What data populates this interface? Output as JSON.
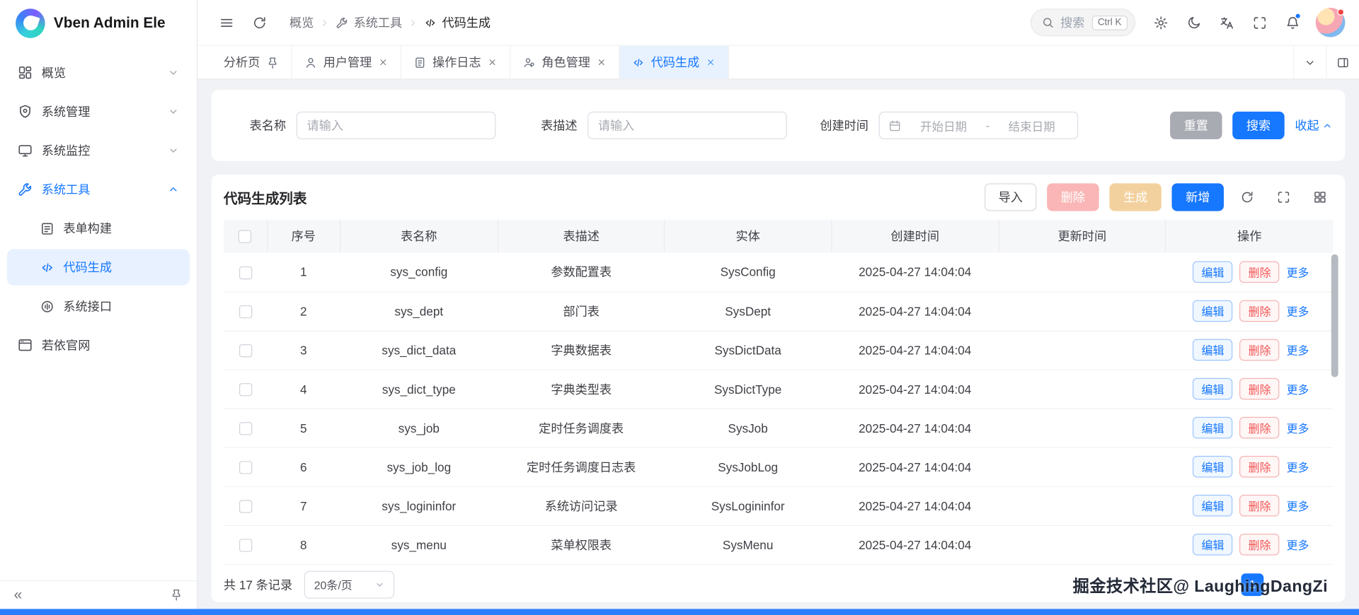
{
  "app": {
    "title": "Vben Admin Ele"
  },
  "colors": {
    "primary": "#1677ff",
    "active_tab_bg": "#e8f2ff",
    "danger_disabled": "#fab6b6",
    "warning_disabled": "#f3d19e"
  },
  "header": {
    "breadcrumb": [
      {
        "id": "overview",
        "label": "概览",
        "icon": ""
      },
      {
        "id": "system-tools",
        "label": "系统工具",
        "icon": "tool"
      },
      {
        "id": "code-generation",
        "label": "代码生成",
        "icon": "code"
      }
    ],
    "search": {
      "placeholder": "搜索",
      "shortcut": "Ctrl K"
    }
  },
  "sidebar": {
    "collapse_glyph": "«",
    "items": [
      {
        "id": "overview",
        "label": "概览",
        "icon": "overview",
        "chevron": "down"
      },
      {
        "id": "system-management",
        "label": "系统管理",
        "icon": "shield",
        "chevron": "down"
      },
      {
        "id": "system-monitor",
        "label": "系统监控",
        "icon": "monitor",
        "chevron": "down"
      },
      {
        "id": "system-tools",
        "label": "系统工具",
        "icon": "tool",
        "chevron": "up",
        "open": true,
        "children": [
          {
            "id": "form-builder",
            "label": "表单构建",
            "icon": "form"
          },
          {
            "id": "code-generation",
            "label": "代码生成",
            "icon": "code",
            "active": true
          },
          {
            "id": "system-api",
            "label": "系统接口",
            "icon": "api"
          }
        ]
      },
      {
        "id": "ruoyi-website",
        "label": "若依官网",
        "icon": "browser"
      }
    ]
  },
  "tabs": [
    {
      "id": "analysis",
      "label": "分析页",
      "icon": "",
      "pinned": true,
      "closable": false
    },
    {
      "id": "user-management",
      "label": "用户管理",
      "icon": "user",
      "closable": true
    },
    {
      "id": "operation-log",
      "label": "操作日志",
      "icon": "log",
      "closable": true
    },
    {
      "id": "role-management",
      "label": "角色管理",
      "icon": "role",
      "closable": true
    },
    {
      "id": "code-generation",
      "label": "代码生成",
      "icon": "code",
      "closable": true,
      "active": true
    }
  ],
  "filter": {
    "table_name": {
      "label": "表名称",
      "placeholder": "请输入"
    },
    "table_desc": {
      "label": "表描述",
      "placeholder": "请输入"
    },
    "create_time": {
      "label": "创建时间",
      "start": "开始日期",
      "separator": "-",
      "end": "结束日期"
    },
    "reset": "重置",
    "search": "搜索",
    "collapse": "收起"
  },
  "list": {
    "title": "代码生成列表",
    "toolbar": {
      "import": "导入",
      "delete": "删除",
      "generate": "生成",
      "add": "新增"
    },
    "columns": [
      "序号",
      "表名称",
      "表描述",
      "实体",
      "创建时间",
      "更新时间",
      "操作"
    ],
    "row_actions": {
      "edit": "编辑",
      "delete": "删除",
      "more": "更多"
    },
    "rows": [
      {
        "no": "1",
        "name": "sys_config",
        "desc": "参数配置表",
        "entity": "SysConfig",
        "created": "2025-04-27 14:04:04",
        "updated": ""
      },
      {
        "no": "2",
        "name": "sys_dept",
        "desc": "部门表",
        "entity": "SysDept",
        "created": "2025-04-27 14:04:04",
        "updated": ""
      },
      {
        "no": "3",
        "name": "sys_dict_data",
        "desc": "字典数据表",
        "entity": "SysDictData",
        "created": "2025-04-27 14:04:04",
        "updated": ""
      },
      {
        "no": "4",
        "name": "sys_dict_type",
        "desc": "字典类型表",
        "entity": "SysDictType",
        "created": "2025-04-27 14:04:04",
        "updated": ""
      },
      {
        "no": "5",
        "name": "sys_job",
        "desc": "定时任务调度表",
        "entity": "SysJob",
        "created": "2025-04-27 14:04:04",
        "updated": ""
      },
      {
        "no": "6",
        "name": "sys_job_log",
        "desc": "定时任务调度日志表",
        "entity": "SysJobLog",
        "created": "2025-04-27 14:04:04",
        "updated": ""
      },
      {
        "no": "7",
        "name": "sys_logininfor",
        "desc": "系统访问记录",
        "entity": "SysLogininfor",
        "created": "2025-04-27 14:04:04",
        "updated": ""
      },
      {
        "no": "8",
        "name": "sys_menu",
        "desc": "菜单权限表",
        "entity": "SysMenu",
        "created": "2025-04-27 14:04:04",
        "updated": ""
      }
    ],
    "pagination": {
      "total": "共 17 条记录",
      "page_size": "20条/页",
      "current": "1"
    }
  },
  "watermark": "掘金技术社区@ LaughingDangZi"
}
